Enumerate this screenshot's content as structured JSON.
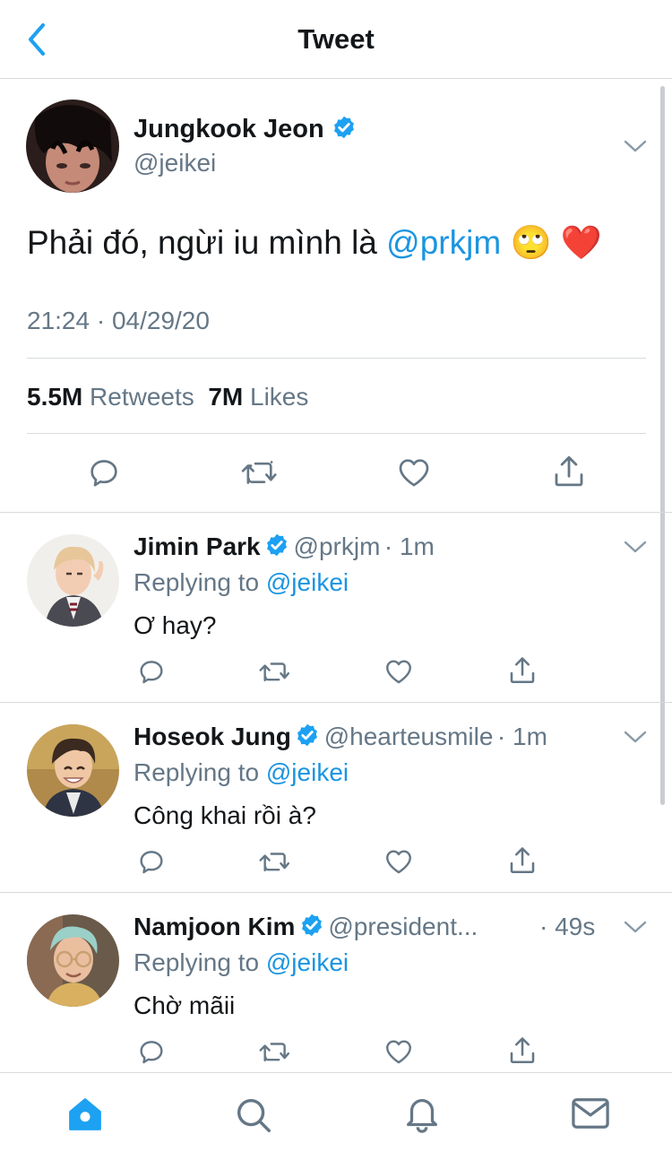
{
  "header": {
    "title": "Tweet"
  },
  "tweet": {
    "author_name": "Jungkook Jeon",
    "author_handle": "@jeikei",
    "text_prefix": "Phải đó, ngừi iu mình là ",
    "mention": "@prkjm",
    "emojis": "🙄 ❤️",
    "timestamp": "21:24 · 04/29/20",
    "retweets_count": "5.5M",
    "retweets_label": "Retweets",
    "likes_count": "7M",
    "likes_label": "Likes"
  },
  "replies": [
    {
      "name": "Jimin Park",
      "handle": "@prkjm",
      "time": "· 1m",
      "replying_label": "Replying to",
      "replying_to": "@jeikei",
      "text": "Ơ hay?"
    },
    {
      "name": "Hoseok Jung",
      "handle": "@hearteusmile",
      "time": "· 1m",
      "replying_label": "Replying to",
      "replying_to": "@jeikei",
      "text": "Công khai rồi à?"
    },
    {
      "name": "Namjoon Kim",
      "handle": "@president...",
      "time": "· 49s",
      "replying_label": "Replying to",
      "replying_to": "@jeikei",
      "text": "Chờ mãii"
    }
  ],
  "icons": {
    "back": "chevron-left-icon",
    "verified": "verified-badge-icon",
    "reply": "comment-icon",
    "retweet": "retweet-icon",
    "like": "heart-icon",
    "share": "share-icon",
    "tabs": [
      "home-icon",
      "search-icon",
      "bell-icon",
      "mail-icon"
    ]
  },
  "colors": {
    "accent": "#1da1f2",
    "link": "#1b95e0",
    "text": "#14171a",
    "secondary": "#657786",
    "divider": "#d7dbde"
  }
}
